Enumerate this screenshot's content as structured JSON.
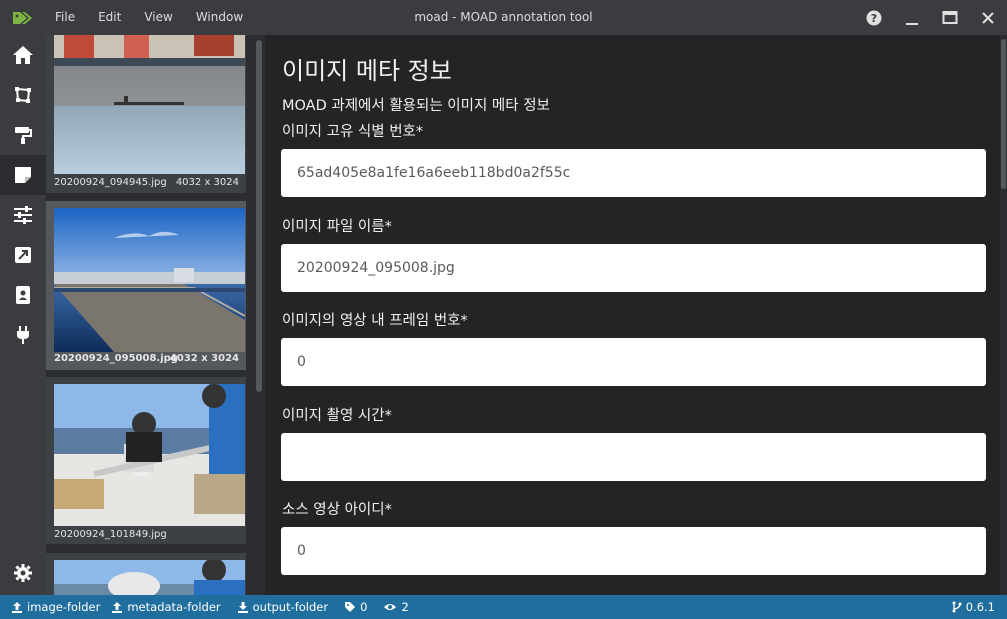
{
  "window": {
    "title": "moad - MOAD annotation tool"
  },
  "menu": [
    "File",
    "Edit",
    "View",
    "Window"
  ],
  "thumbnails": [
    {
      "name": "20200924_094945.jpg",
      "size": "4032 x 3024",
      "selected": false
    },
    {
      "name": "20200924_095008.jpg",
      "size": "4032 x 3024",
      "selected": true
    },
    {
      "name": "20200924_101849.jpg",
      "size": "",
      "selected": false
    }
  ],
  "main": {
    "title": "이미지 메타 정보",
    "subtitle": "MOAD 과제에서 활용되는 이미지 메타 정보",
    "fields": [
      {
        "label": "이미지 고유 식별 번호*",
        "value": "65ad405e8a1fe16a6eeb118bd0a2f55c"
      },
      {
        "label": "이미지 파일 이름*",
        "value": "20200924_095008.jpg"
      },
      {
        "label": "이미지의 영상 내 프레임 번호*",
        "value": "0"
      },
      {
        "label": "이미지 촬영 시간*",
        "value": ""
      },
      {
        "label": "소스 영상 아이디*",
        "value": "0"
      }
    ]
  },
  "statusbar": {
    "image_folder": "image-folder",
    "metadata_folder": "metadata-folder",
    "output_folder": "output-folder",
    "tag_count": "0",
    "view_count": "2",
    "version": "0.6.1"
  },
  "colors": {
    "accent": "#1f6e9e",
    "logo": "#7cb342"
  },
  "icons": [
    "tag-icon",
    "help-icon",
    "minimize-icon",
    "maximize-icon",
    "close-icon",
    "home-icon",
    "crop-icon",
    "paint-roller-icon",
    "sticky-note-icon",
    "sliders-icon",
    "external-link-icon",
    "address-book-icon",
    "plug-icon",
    "gear-icon",
    "upload-icon",
    "download-icon",
    "eye-icon",
    "code-branch-icon"
  ]
}
